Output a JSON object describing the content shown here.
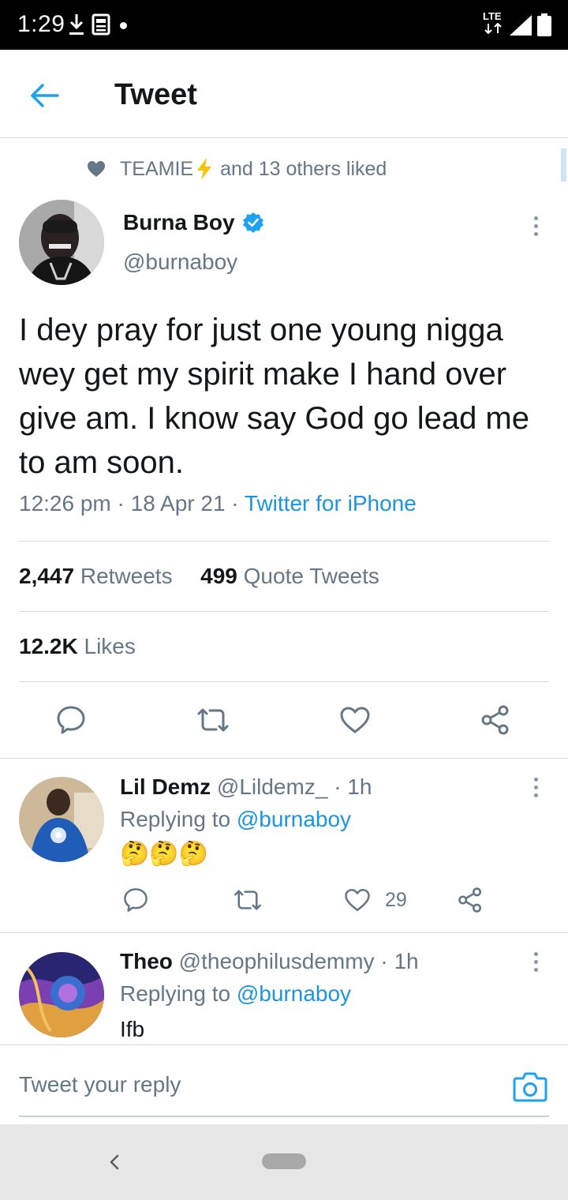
{
  "status_bar": {
    "time": "1:29",
    "network": "LTE"
  },
  "header": {
    "title": "Tweet"
  },
  "social_context": {
    "name": "TEAMIE",
    "rest": "and 13 others liked"
  },
  "tweet": {
    "author_name": "Burna Boy",
    "author_handle": "@burnaboy",
    "text": "I dey pray for just one young nigga wey get my spirit make I hand over give am. I know say God go lead me to am soon.",
    "time": "12:26 pm",
    "date": "18 Apr 21",
    "source": "Twitter for iPhone",
    "retweets_count": "2,447",
    "retweets_label": "Retweets",
    "quotes_count": "499",
    "quotes_label": "Quote Tweets",
    "likes_count": "12.2K",
    "likes_label": "Likes"
  },
  "replies": [
    {
      "name": "Lil Demz",
      "handle": "@Lildemz_",
      "age": "1h",
      "replying_label": "Replying to",
      "replying_to": "@burnaboy",
      "text": "🤔🤔🤔",
      "like_count": "29"
    },
    {
      "name": "Theo",
      "handle": "@theophilusdemmy",
      "age": "1h",
      "replying_label": "Replying to",
      "replying_to": "@burnaboy",
      "text": "Ifb"
    }
  ],
  "composer": {
    "placeholder": "Tweet your reply"
  },
  "colors": {
    "accent": "#1da1f2",
    "link": "#1b95e0",
    "secondary_text": "#657786",
    "primary_text": "#14171a",
    "bolt": "#f5c400"
  }
}
